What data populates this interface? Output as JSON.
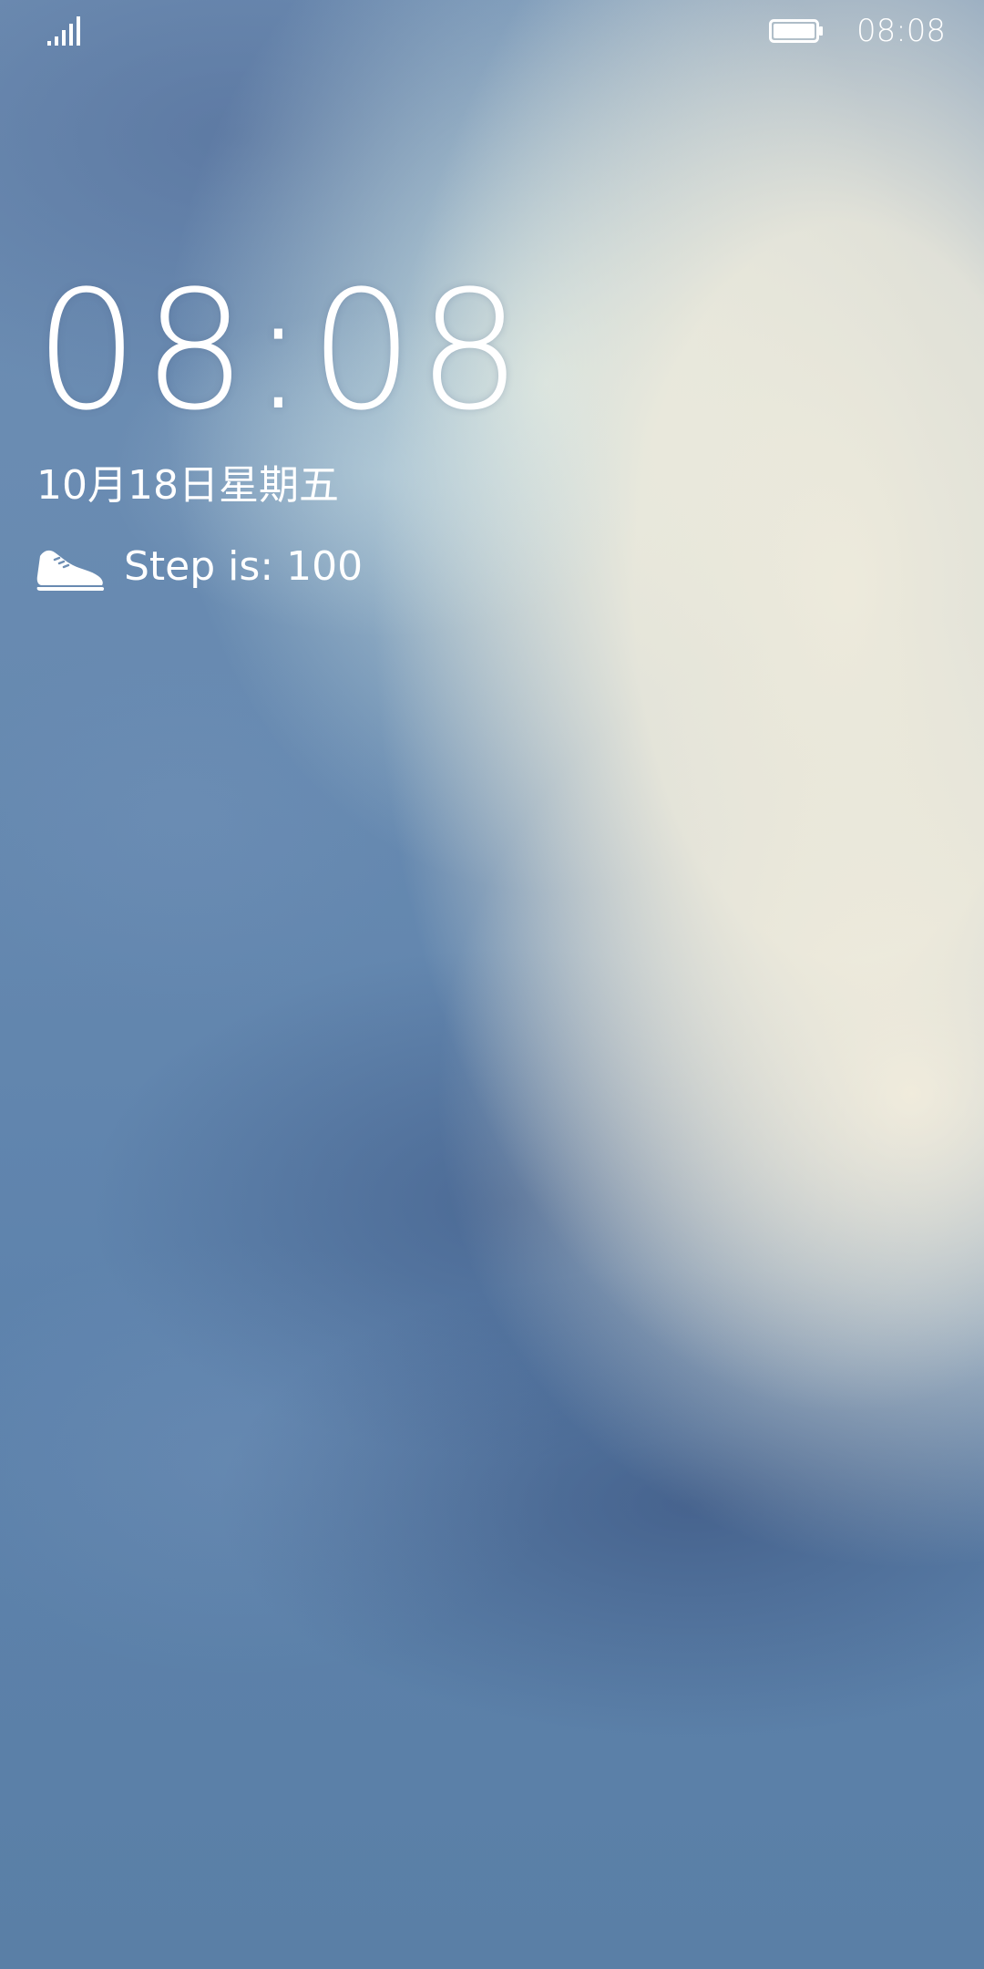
{
  "status_bar": {
    "time": "08:08",
    "signal_icon": "signal-icon",
    "battery_icon": "battery-icon"
  },
  "lock_screen": {
    "clock": "08:08",
    "date": "10月18日星期五",
    "steps_icon": "shoe-icon",
    "steps_text": "Step is: 100"
  }
}
